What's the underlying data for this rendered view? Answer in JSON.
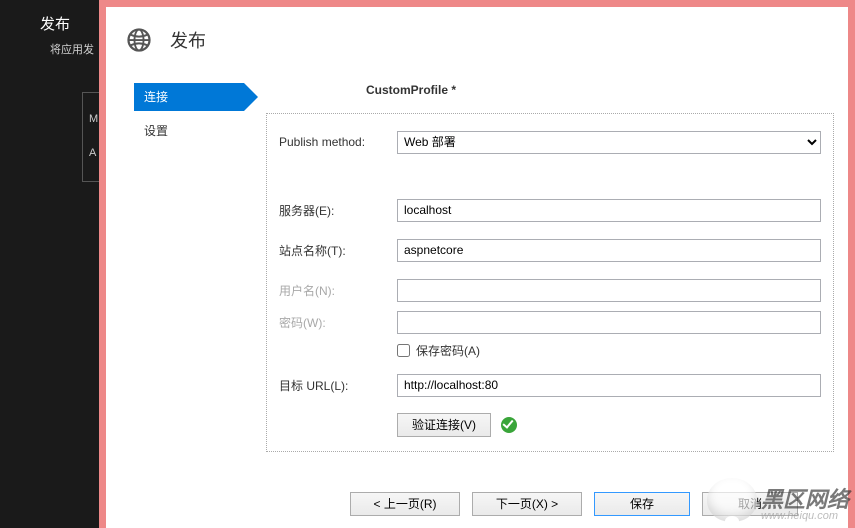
{
  "outer": {
    "title": "发布",
    "subtitle": "将应用发",
    "clip_line1": "M",
    "clip_line2": "A"
  },
  "dialog": {
    "title": "发布"
  },
  "steps": {
    "connect": "连接",
    "settings": "设置"
  },
  "profile": {
    "name": "CustomProfile *"
  },
  "form": {
    "publish_method_label": "Publish method:",
    "publish_method_value": "Web 部署",
    "server_label": "服务器(E):",
    "server_value": "localhost",
    "site_label": "站点名称(T):",
    "site_value": "aspnetcore",
    "user_label": "用户名(N):",
    "user_value": "",
    "password_label": "密码(W):",
    "password_value": "",
    "save_password_label": "保存密码(A)",
    "url_label": "目标 URL(L):",
    "url_value": "http://localhost:80",
    "validate_label": "验证连接(V)"
  },
  "footer": {
    "prev": "< 上一页(R)",
    "next": "下一页(X) >",
    "save": "保存",
    "cancel": "取消"
  },
  "watermark": {
    "brand": "黑区网络",
    "url": "www.heiqu.com"
  }
}
